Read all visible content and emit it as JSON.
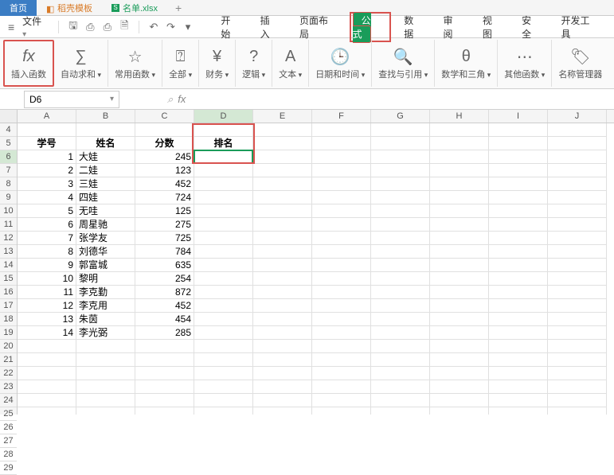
{
  "app_tabs": {
    "home": "首页",
    "template": "稻壳模板",
    "file": "名单.xlsx"
  },
  "file_menu": "文件",
  "menus": [
    "开始",
    "插入",
    "页面布局",
    "公式",
    "数据",
    "审阅",
    "视图",
    "安全",
    "开发工具"
  ],
  "active_menu": "公式",
  "ribbon": {
    "insert_fn": "插入函数",
    "autosum": "自动求和",
    "common": "常用函数",
    "all": "全部",
    "finance": "财务",
    "logic": "逻辑",
    "text": "文本",
    "datetime": "日期和时间",
    "lookup": "查找与引用",
    "math": "数学和三角",
    "other": "其他函数",
    "name_mgr": "名称管理器"
  },
  "name_box": "D6",
  "fx": "fx",
  "columns": [
    "A",
    "B",
    "C",
    "D",
    "E",
    "F",
    "G",
    "H",
    "I",
    "J"
  ],
  "row_start": 4,
  "row_end": 29,
  "header_row": {
    "a": "学号",
    "b": "姓名",
    "c": "分数",
    "d": "排名"
  },
  "rows": [
    {
      "a": "1",
      "b": "大娃",
      "c": "245"
    },
    {
      "a": "2",
      "b": "二娃",
      "c": "123"
    },
    {
      "a": "3",
      "b": "三娃",
      "c": "452"
    },
    {
      "a": "4",
      "b": "四娃",
      "c": "724"
    },
    {
      "a": "5",
      "b": "无哇",
      "c": "125"
    },
    {
      "a": "6",
      "b": "周星驰",
      "c": "275"
    },
    {
      "a": "7",
      "b": "张学友",
      "c": "725"
    },
    {
      "a": "8",
      "b": "刘德华",
      "c": "784"
    },
    {
      "a": "9",
      "b": "郭富城",
      "c": "635"
    },
    {
      "a": "10",
      "b": "黎明",
      "c": "254"
    },
    {
      "a": "11",
      "b": "李克勤",
      "c": "872"
    },
    {
      "a": "12",
      "b": "李克用",
      "c": "452"
    },
    {
      "a": "13",
      "b": "朱茵",
      "c": "454"
    },
    {
      "a": "14",
      "b": "李光弼",
      "c": "285"
    }
  ]
}
